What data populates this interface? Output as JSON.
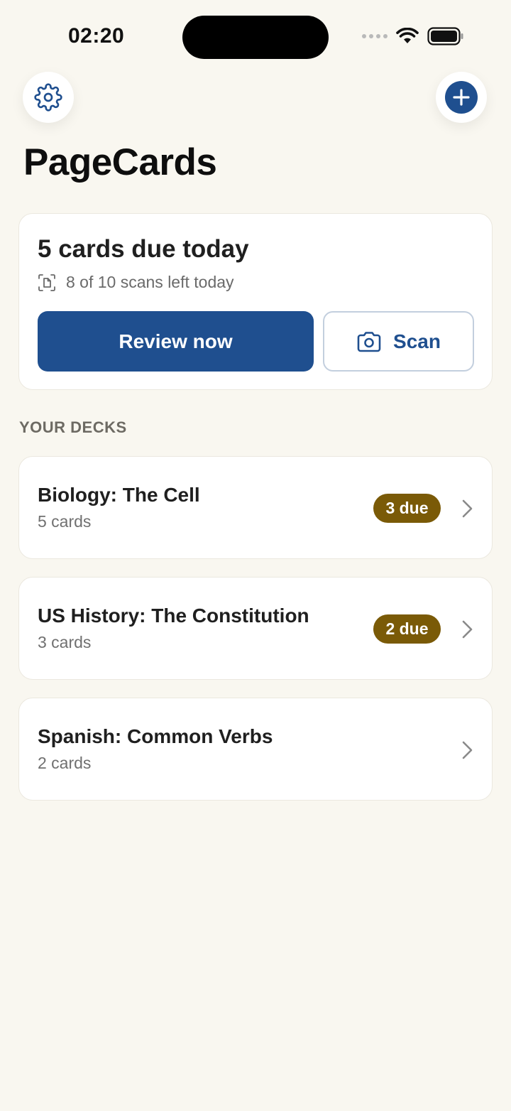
{
  "status_bar": {
    "time": "02:20"
  },
  "header": {
    "settings_icon": "gear-icon",
    "add_icon": "plus-icon",
    "title": "PageCards"
  },
  "summary": {
    "title": "5 cards due today",
    "scans_icon": "document-scan-icon",
    "scans_text": "8 of 10 scans left today",
    "review_label": "Review now",
    "scan_label": "Scan",
    "scan_icon": "camera-icon"
  },
  "decks_section": {
    "label": "YOUR DECKS",
    "items": [
      {
        "name": "Biology: The Cell",
        "count": "5 cards",
        "due": "3 due"
      },
      {
        "name": "US History: The Constitution",
        "count": "3 cards",
        "due": "2 due"
      },
      {
        "name": "Spanish: Common Verbs",
        "count": "2 cards",
        "due": ""
      }
    ]
  },
  "colors": {
    "background": "#f9f7f0",
    "primary": "#1f4f8f",
    "due_badge": "#7a5a07"
  }
}
